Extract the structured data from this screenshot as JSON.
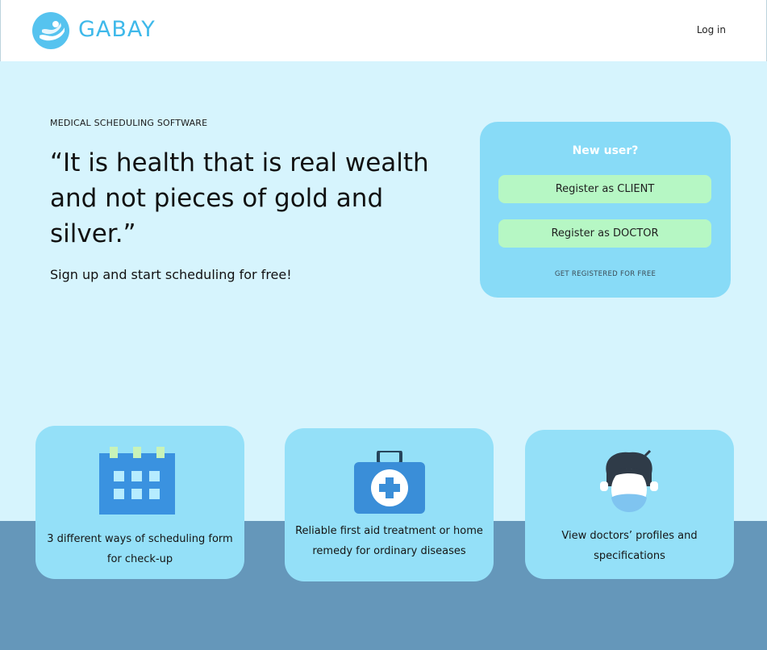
{
  "header": {
    "brand": "GABAY",
    "login_label": "Log in"
  },
  "hero": {
    "tagline": "MEDICAL SCHEDULING SOFTWARE",
    "quote": "“It is health that is real wealth and not pieces of gold and silver.”",
    "signup_text": "Sign up and start scheduling for free!"
  },
  "register": {
    "title": "New user?",
    "client_label": "Register as CLIENT",
    "doctor_label": "Register as DOCTOR",
    "note": "GET REGISTERED FOR FREE"
  },
  "features": [
    {
      "icon": "calendar-icon",
      "text": "3 different ways of scheduling form for check-up"
    },
    {
      "icon": "first-aid-kit-icon",
      "text": "Reliable first aid treatment or home remedy for ordinary diseases"
    },
    {
      "icon": "masked-doctor-icon",
      "text": "View doctors’ profiles and specifications"
    }
  ],
  "colors": {
    "brand": "#3fb9ea",
    "hero_background": "#d6f4fd",
    "register_card": "#88dbf7",
    "register_button": "#b6f7c4",
    "feature_card": "#94e0f8",
    "bottom_band": "#6597ba"
  }
}
